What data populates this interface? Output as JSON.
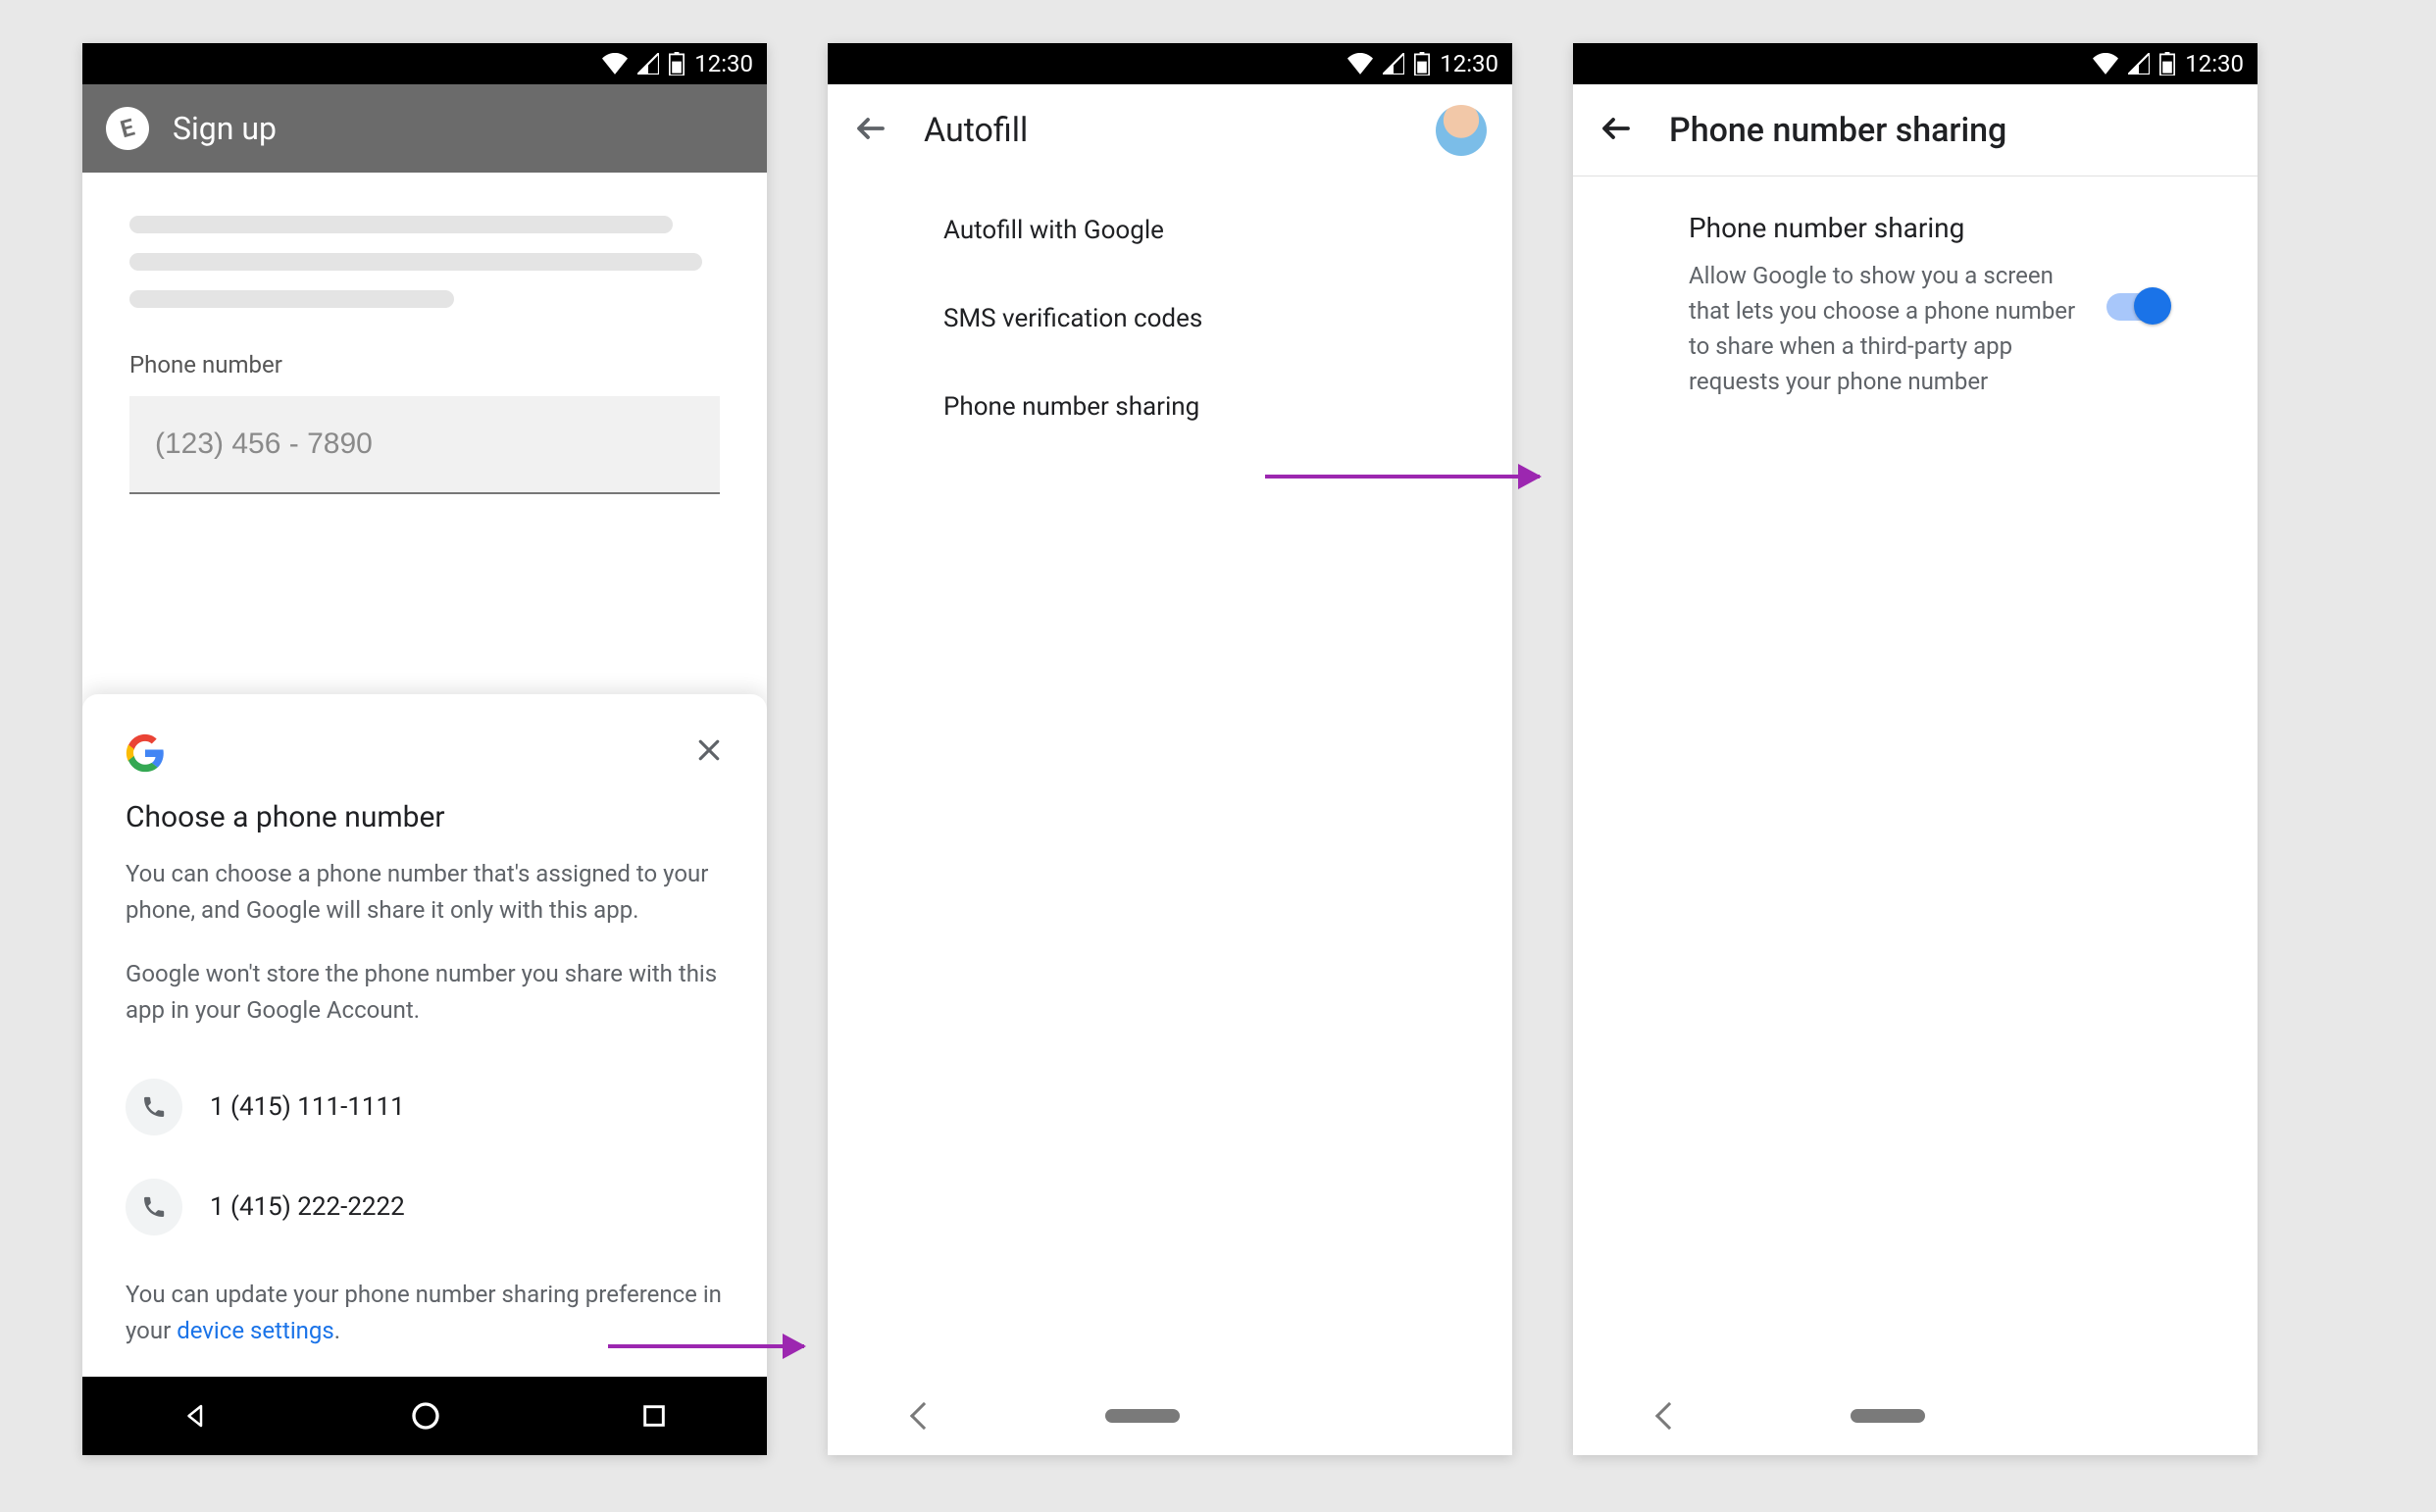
{
  "statusbar": {
    "time": "12:30"
  },
  "screen1": {
    "app_title": "Sign up",
    "field_label": "Phone number",
    "field_placeholder": "(123) 456 - 7890",
    "sheet": {
      "title": "Choose a phone number",
      "body1": "You can choose a phone number that's assigned to your phone, and Google will share it only with this app.",
      "body2": "Google won't store the phone number you share with this app in your Google Account.",
      "numbers": [
        "1 (415) 111-1111",
        "1 (415) 222-2222"
      ],
      "footer_pre": "You can update your phone number sharing preference in your ",
      "footer_link": "device settings",
      "footer_post": "."
    }
  },
  "screen2": {
    "title": "Autofill",
    "items": [
      "Autofill with Google",
      "SMS verification codes",
      "Phone number sharing"
    ]
  },
  "screen3": {
    "title": "Phone number sharing",
    "setting_title": "Phone number sharing",
    "setting_desc": "Allow Google to show you a screen that lets you choose a phone number to share when a third-party app requests your phone number"
  }
}
